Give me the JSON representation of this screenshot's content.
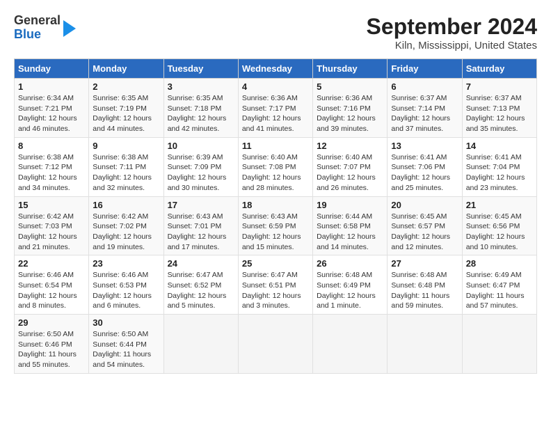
{
  "logo": {
    "general": "General",
    "blue": "Blue"
  },
  "title": "September 2024",
  "subtitle": "Kiln, Mississippi, United States",
  "days_of_week": [
    "Sunday",
    "Monday",
    "Tuesday",
    "Wednesday",
    "Thursday",
    "Friday",
    "Saturday"
  ],
  "weeks": [
    [
      {
        "day": "1",
        "sunrise": "Sunrise: 6:34 AM",
        "sunset": "Sunset: 7:21 PM",
        "daylight": "Daylight: 12 hours and 46 minutes."
      },
      {
        "day": "2",
        "sunrise": "Sunrise: 6:35 AM",
        "sunset": "Sunset: 7:19 PM",
        "daylight": "Daylight: 12 hours and 44 minutes."
      },
      {
        "day": "3",
        "sunrise": "Sunrise: 6:35 AM",
        "sunset": "Sunset: 7:18 PM",
        "daylight": "Daylight: 12 hours and 42 minutes."
      },
      {
        "day": "4",
        "sunrise": "Sunrise: 6:36 AM",
        "sunset": "Sunset: 7:17 PM",
        "daylight": "Daylight: 12 hours and 41 minutes."
      },
      {
        "day": "5",
        "sunrise": "Sunrise: 6:36 AM",
        "sunset": "Sunset: 7:16 PM",
        "daylight": "Daylight: 12 hours and 39 minutes."
      },
      {
        "day": "6",
        "sunrise": "Sunrise: 6:37 AM",
        "sunset": "Sunset: 7:14 PM",
        "daylight": "Daylight: 12 hours and 37 minutes."
      },
      {
        "day": "7",
        "sunrise": "Sunrise: 6:37 AM",
        "sunset": "Sunset: 7:13 PM",
        "daylight": "Daylight: 12 hours and 35 minutes."
      }
    ],
    [
      {
        "day": "8",
        "sunrise": "Sunrise: 6:38 AM",
        "sunset": "Sunset: 7:12 PM",
        "daylight": "Daylight: 12 hours and 34 minutes."
      },
      {
        "day": "9",
        "sunrise": "Sunrise: 6:38 AM",
        "sunset": "Sunset: 7:11 PM",
        "daylight": "Daylight: 12 hours and 32 minutes."
      },
      {
        "day": "10",
        "sunrise": "Sunrise: 6:39 AM",
        "sunset": "Sunset: 7:09 PM",
        "daylight": "Daylight: 12 hours and 30 minutes."
      },
      {
        "day": "11",
        "sunrise": "Sunrise: 6:40 AM",
        "sunset": "Sunset: 7:08 PM",
        "daylight": "Daylight: 12 hours and 28 minutes."
      },
      {
        "day": "12",
        "sunrise": "Sunrise: 6:40 AM",
        "sunset": "Sunset: 7:07 PM",
        "daylight": "Daylight: 12 hours and 26 minutes."
      },
      {
        "day": "13",
        "sunrise": "Sunrise: 6:41 AM",
        "sunset": "Sunset: 7:06 PM",
        "daylight": "Daylight: 12 hours and 25 minutes."
      },
      {
        "day": "14",
        "sunrise": "Sunrise: 6:41 AM",
        "sunset": "Sunset: 7:04 PM",
        "daylight": "Daylight: 12 hours and 23 minutes."
      }
    ],
    [
      {
        "day": "15",
        "sunrise": "Sunrise: 6:42 AM",
        "sunset": "Sunset: 7:03 PM",
        "daylight": "Daylight: 12 hours and 21 minutes."
      },
      {
        "day": "16",
        "sunrise": "Sunrise: 6:42 AM",
        "sunset": "Sunset: 7:02 PM",
        "daylight": "Daylight: 12 hours and 19 minutes."
      },
      {
        "day": "17",
        "sunrise": "Sunrise: 6:43 AM",
        "sunset": "Sunset: 7:01 PM",
        "daylight": "Daylight: 12 hours and 17 minutes."
      },
      {
        "day": "18",
        "sunrise": "Sunrise: 6:43 AM",
        "sunset": "Sunset: 6:59 PM",
        "daylight": "Daylight: 12 hours and 15 minutes."
      },
      {
        "day": "19",
        "sunrise": "Sunrise: 6:44 AM",
        "sunset": "Sunset: 6:58 PM",
        "daylight": "Daylight: 12 hours and 14 minutes."
      },
      {
        "day": "20",
        "sunrise": "Sunrise: 6:45 AM",
        "sunset": "Sunset: 6:57 PM",
        "daylight": "Daylight: 12 hours and 12 minutes."
      },
      {
        "day": "21",
        "sunrise": "Sunrise: 6:45 AM",
        "sunset": "Sunset: 6:56 PM",
        "daylight": "Daylight: 12 hours and 10 minutes."
      }
    ],
    [
      {
        "day": "22",
        "sunrise": "Sunrise: 6:46 AM",
        "sunset": "Sunset: 6:54 PM",
        "daylight": "Daylight: 12 hours and 8 minutes."
      },
      {
        "day": "23",
        "sunrise": "Sunrise: 6:46 AM",
        "sunset": "Sunset: 6:53 PM",
        "daylight": "Daylight: 12 hours and 6 minutes."
      },
      {
        "day": "24",
        "sunrise": "Sunrise: 6:47 AM",
        "sunset": "Sunset: 6:52 PM",
        "daylight": "Daylight: 12 hours and 5 minutes."
      },
      {
        "day": "25",
        "sunrise": "Sunrise: 6:47 AM",
        "sunset": "Sunset: 6:51 PM",
        "daylight": "Daylight: 12 hours and 3 minutes."
      },
      {
        "day": "26",
        "sunrise": "Sunrise: 6:48 AM",
        "sunset": "Sunset: 6:49 PM",
        "daylight": "Daylight: 12 hours and 1 minute."
      },
      {
        "day": "27",
        "sunrise": "Sunrise: 6:48 AM",
        "sunset": "Sunset: 6:48 PM",
        "daylight": "Daylight: 11 hours and 59 minutes."
      },
      {
        "day": "28",
        "sunrise": "Sunrise: 6:49 AM",
        "sunset": "Sunset: 6:47 PM",
        "daylight": "Daylight: 11 hours and 57 minutes."
      }
    ],
    [
      {
        "day": "29",
        "sunrise": "Sunrise: 6:50 AM",
        "sunset": "Sunset: 6:46 PM",
        "daylight": "Daylight: 11 hours and 55 minutes."
      },
      {
        "day": "30",
        "sunrise": "Sunrise: 6:50 AM",
        "sunset": "Sunset: 6:44 PM",
        "daylight": "Daylight: 11 hours and 54 minutes."
      },
      null,
      null,
      null,
      null,
      null
    ]
  ]
}
